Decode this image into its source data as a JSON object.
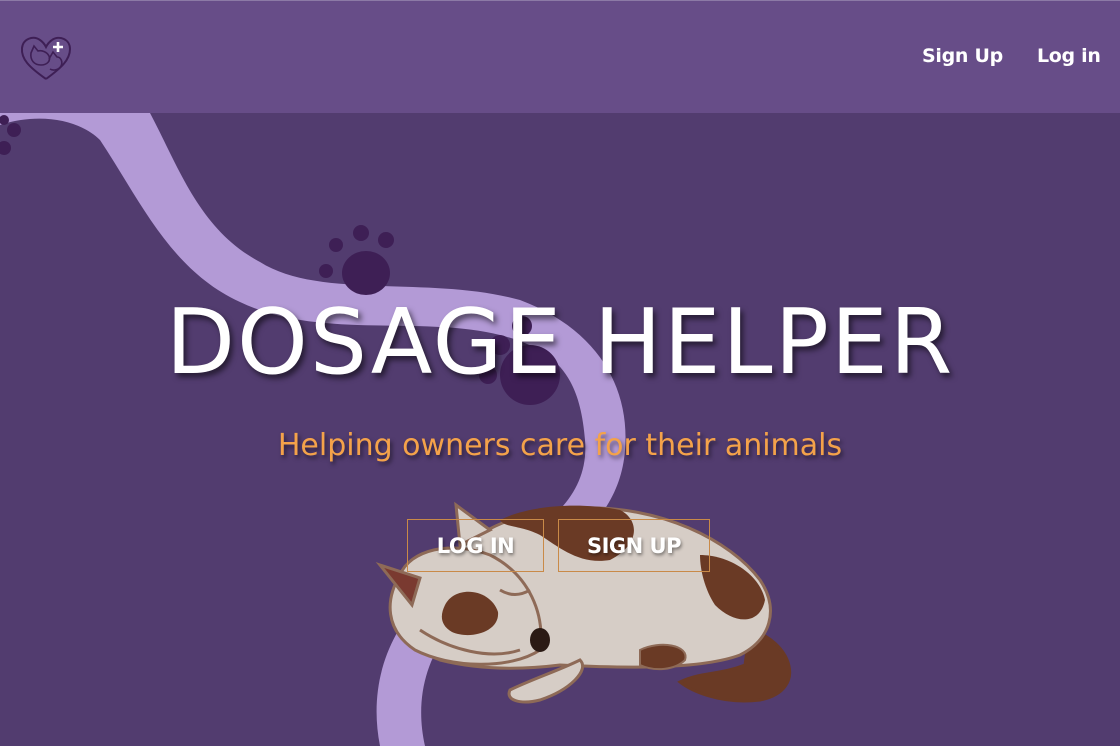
{
  "nav": {
    "logo_icon": "heart-paw-medical-logo",
    "signup_label": "Sign Up",
    "login_label": "Log in"
  },
  "hero": {
    "title": "DOSAGE HELPER",
    "subtitle": "Helping owners care for their animals",
    "login_button": "LOG IN",
    "signup_button": "SIGN UP"
  },
  "colors": {
    "navbar": "#674d88",
    "background": "#523c6f",
    "path": "#b39ad6",
    "paw": "#3e1f55",
    "subtitle": "#f4a24a",
    "button_border": "#c98a48"
  }
}
